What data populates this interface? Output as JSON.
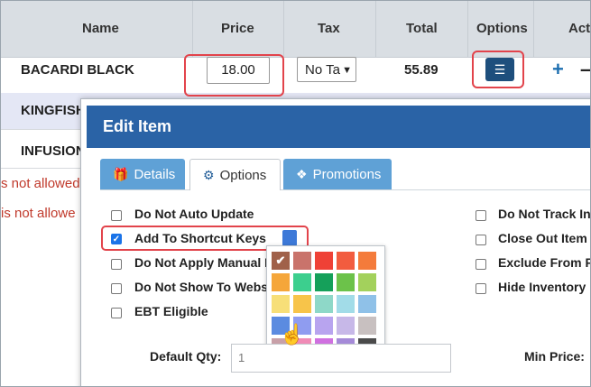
{
  "table": {
    "headers": {
      "name": "Name",
      "price": "Price",
      "tax": "Tax",
      "total": "Total",
      "options": "Options",
      "actions": "Acti"
    },
    "rows": [
      {
        "name": "BACARDI BLACK",
        "price": "18.00",
        "tax": "No Ta",
        "total": "55.89"
      },
      {
        "name": "KINGFISH"
      },
      {
        "name": "INFUSION"
      }
    ],
    "errors": [
      "s not allowed",
      "is not allowe"
    ]
  },
  "modal": {
    "title": "Edit Item",
    "tabs": {
      "details": "Details",
      "options": "Options",
      "promotions": "Promotions"
    },
    "left_options": [
      {
        "label": "Do Not Auto Update",
        "checked": false
      },
      {
        "label": "Add To Shortcut Keys",
        "checked": true
      },
      {
        "label": "Do Not Apply Manual I",
        "checked": false
      },
      {
        "label": "Do Not Show To Webs",
        "checked": false
      },
      {
        "label": "EBT Eligible",
        "checked": false
      }
    ],
    "right_options": [
      {
        "label": "Do Not Track In",
        "checked": false
      },
      {
        "label": "Close Out Item",
        "checked": false
      },
      {
        "label": "Exclude From F",
        "checked": false
      },
      {
        "label": "Hide Inventory",
        "checked": false
      }
    ],
    "shortcut_color": "#3d79d8",
    "palette_colors": [
      "#a0614a",
      "#c9736b",
      "#ef4136",
      "#f25c3f",
      "#f47b3b",
      "#f5a63a",
      "#3ccf8e",
      "#15a05a",
      "#6cc24a",
      "#a3d15c",
      "#f7df78",
      "#f7c44a",
      "#8ed8c8",
      "#a2dce8",
      "#8fc1e8",
      "#5b8be0",
      "#8f9cf0",
      "#b8a4ef",
      "#c7b8e8",
      "#c8c0c0",
      "#c8a0a8",
      "#f08bb6",
      "#d070e0",
      "#a58ad8",
      "#4a4a4a"
    ],
    "palette_selected_index": 0,
    "fields": {
      "default_qty_label": "Default Qty:",
      "default_qty_value": "1",
      "min_price_label": "Min Price:"
    }
  }
}
